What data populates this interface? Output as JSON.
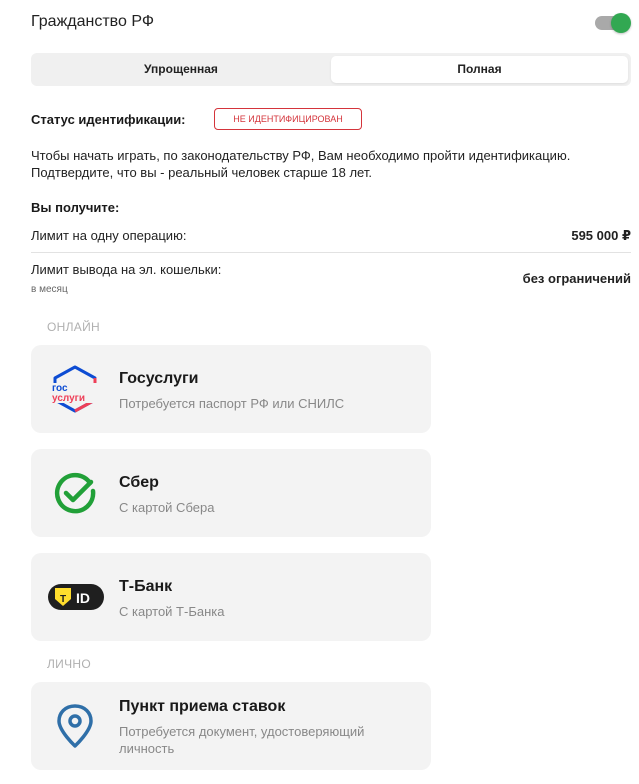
{
  "header": {
    "title": "Гражданство РФ",
    "toggle_on": true,
    "toggle_color": "#32a852"
  },
  "segments": {
    "simplified": "Упрощенная",
    "full": "Полная",
    "active": "full"
  },
  "status": {
    "label": "Статус идентификации:",
    "badge": "НЕ ИДЕНТИФИЦИРОВАН",
    "badge_color": "#d4343b"
  },
  "info_text": "Чтобы начать играть, по законодательству РФ, Вам необходимо пройти идентификацию. Подтвердите, что вы - реальный человек старше 18 лет.",
  "receive": {
    "title": "Вы получите:",
    "limits": [
      {
        "label": "Лимит на одну операцию:",
        "sub": "",
        "value": "595 000 ₽"
      },
      {
        "label": "Лимит вывода на эл. кошельки:",
        "sub": "в месяц",
        "value": "без ограничений"
      }
    ]
  },
  "sections": {
    "online": "ОНЛАЙН",
    "personal": "ЛИЧНО"
  },
  "methods": [
    {
      "icon": "gosuslugi-logo-icon",
      "icon_text_top": "гос",
      "icon_text_bottom": "услуги",
      "title": "Госуслуги",
      "desc": "Потребуется паспорт РФ или СНИЛС"
    },
    {
      "icon": "sber-check-icon",
      "title": "Сбер",
      "desc": "С картой Сбера"
    },
    {
      "icon": "tbank-id-icon",
      "icon_text_t": "T",
      "icon_text_id": "ID",
      "title": "Т-Банк",
      "desc": "С картой Т-Банка"
    },
    {
      "icon": "location-pin-icon",
      "title": "Пункт приема ставок",
      "desc": "Потребуется документ, удостоверяющий личность"
    }
  ]
}
